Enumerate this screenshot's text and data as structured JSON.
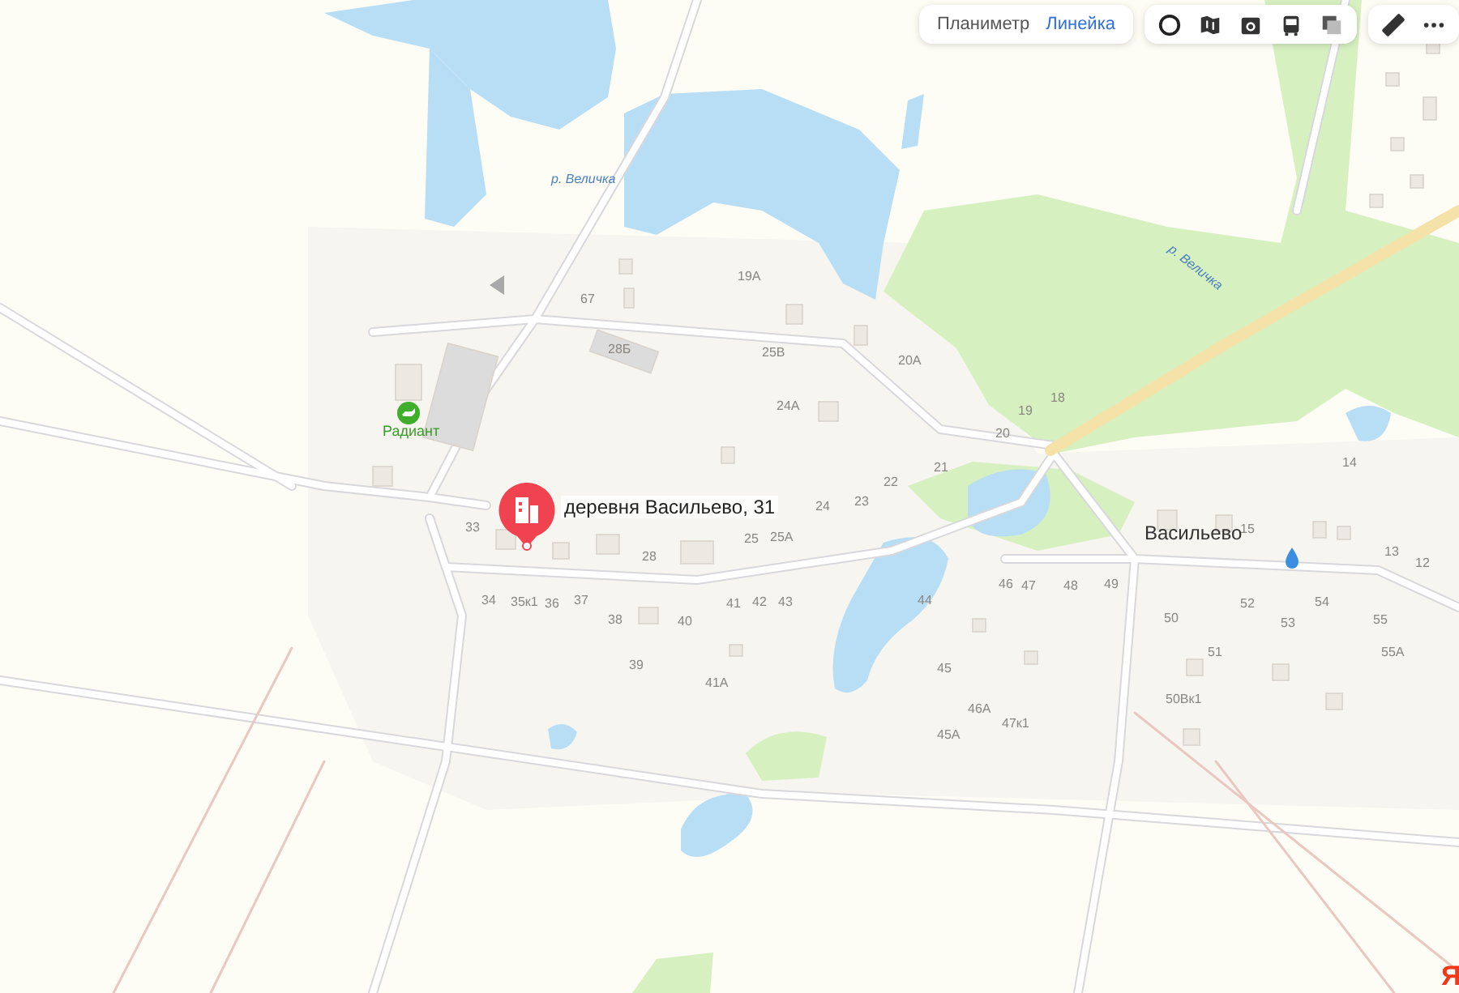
{
  "toolbar": {
    "measure_tabs": [
      {
        "label": "Планиметр",
        "selected": false
      },
      {
        "label": "Линейка",
        "selected": true
      }
    ]
  },
  "map": {
    "place_labels": [
      {
        "text": "р. Величка",
        "kind": "river"
      },
      {
        "text": "р. Величка",
        "kind": "river"
      },
      {
        "text": "Радиант",
        "kind": "poi"
      },
      {
        "text": "Васильево",
        "kind": "village"
      }
    ],
    "house_numbers": [
      "19А",
      "67",
      "28Б",
      "25В",
      "20А",
      "18",
      "24А",
      "19",
      "20",
      "14",
      "21",
      "22",
      "23",
      "24",
      "33",
      "15",
      "25А",
      "25",
      "13",
      "28",
      "12",
      "46",
      "47",
      "48",
      "49",
      "34",
      "35к1",
      "36",
      "37",
      "41",
      "42",
      "43",
      "44",
      "52",
      "54",
      "38",
      "40",
      "50",
      "53",
      "55",
      "51",
      "55А",
      "39",
      "45",
      "41А",
      "50Вк1",
      "46А",
      "47к1",
      "45А"
    ],
    "marker": {
      "label": "деревня Васильево, 31"
    }
  },
  "logo": {
    "text": "Я"
  }
}
